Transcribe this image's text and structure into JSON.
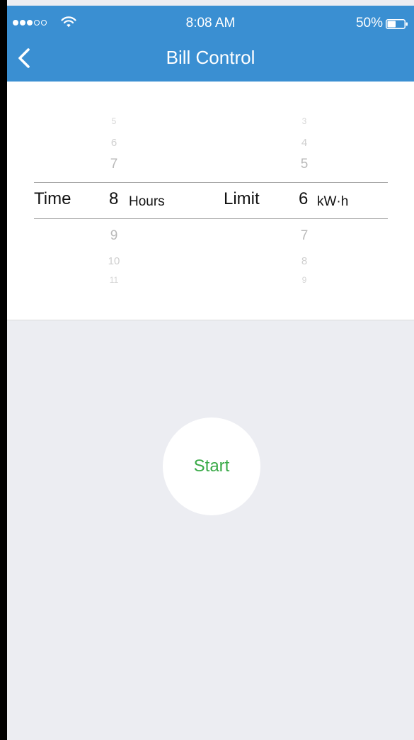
{
  "status_bar": {
    "signal_strength": 3,
    "signal_total": 5,
    "time": "8:08 AM",
    "battery_percent": "50%",
    "battery_level": 0.5
  },
  "header": {
    "title": "Bill Control",
    "color": "#3a8fd2"
  },
  "time_picker": {
    "label": "Time",
    "above": [
      "5",
      "6",
      "7"
    ],
    "value": "8",
    "unit": "Hours",
    "below": [
      "9",
      "10",
      "11"
    ]
  },
  "limit_picker": {
    "label": "Limit",
    "above": [
      "3",
      "4",
      "5"
    ],
    "value": "6",
    "unit": "kW·h",
    "below": [
      "7",
      "8",
      "9"
    ]
  },
  "start_button": {
    "label": "Start",
    "color": "#3aaa48"
  }
}
